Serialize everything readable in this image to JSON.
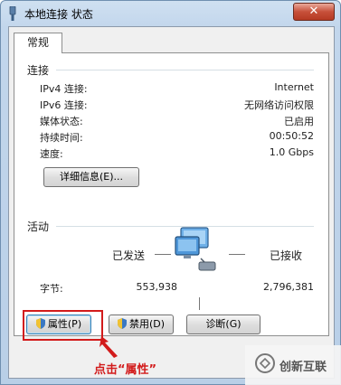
{
  "window": {
    "title": "本地连接 状态",
    "close_label": "✕"
  },
  "tab": {
    "label": "常规"
  },
  "connection": {
    "group_label": "连接",
    "rows": [
      {
        "label": "IPv4 连接:",
        "value": "Internet"
      },
      {
        "label": "IPv6 连接:",
        "value": "无网络访问权限"
      },
      {
        "label": "媒体状态:",
        "value": "已启用"
      },
      {
        "label": "持续时间:",
        "value": "00:50:52"
      },
      {
        "label": "速度:",
        "value": "1.0 Gbps"
      }
    ],
    "details_button": "详细信息(E)..."
  },
  "activity": {
    "group_label": "活动",
    "sent_label": "已发送",
    "received_label": "已接收",
    "bytes_label": "字节:",
    "bytes_sent": "553,938",
    "bytes_received": "2,796,381"
  },
  "buttons": {
    "properties": "属性(P)",
    "disable": "禁用(D)",
    "diagnose": "诊断(G)"
  },
  "annotation": {
    "text": "点击“属性”"
  },
  "watermark": {
    "text": "创新互联"
  },
  "colors": {
    "accent_red": "#d21b1b",
    "window_frame": "#b9cfe7"
  }
}
